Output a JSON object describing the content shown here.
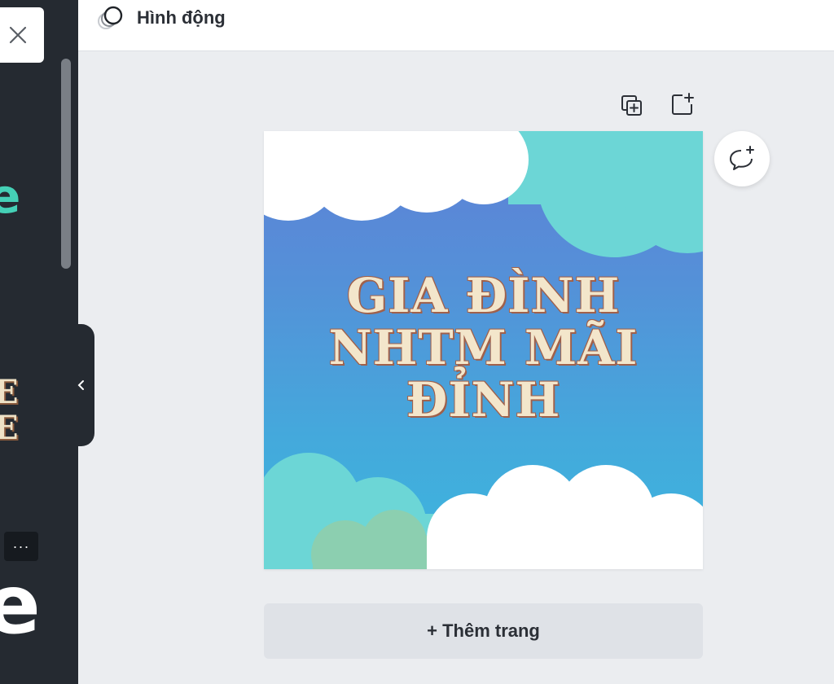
{
  "topbar": {
    "animate_label": "Hình động"
  },
  "sidebar": {
    "swirl_glyph": "e",
    "letter_stack": [
      "E",
      "E"
    ],
    "more_label": "···",
    "big_letter": "e"
  },
  "canvas": {
    "title_lines": [
      "GIA ĐÌNH",
      "NHTM MÃI",
      "ĐỈNH"
    ],
    "colors": {
      "sky_top": "#5f7fd6",
      "sky_bottom": "#3cb6de",
      "cloud_white": "#ffffff",
      "cloud_teal": "#6cd6d6",
      "cloud_green": "#8ccfb0",
      "title_fill": "#f3e6cb",
      "title_outline": "#a0604a"
    }
  },
  "add_page": {
    "label": "+ Thêm trang"
  },
  "colors": {
    "sidebar_bg": "#252a31",
    "workspace_bg": "#ebedf0",
    "accent_teal": "#45d0b6"
  }
}
